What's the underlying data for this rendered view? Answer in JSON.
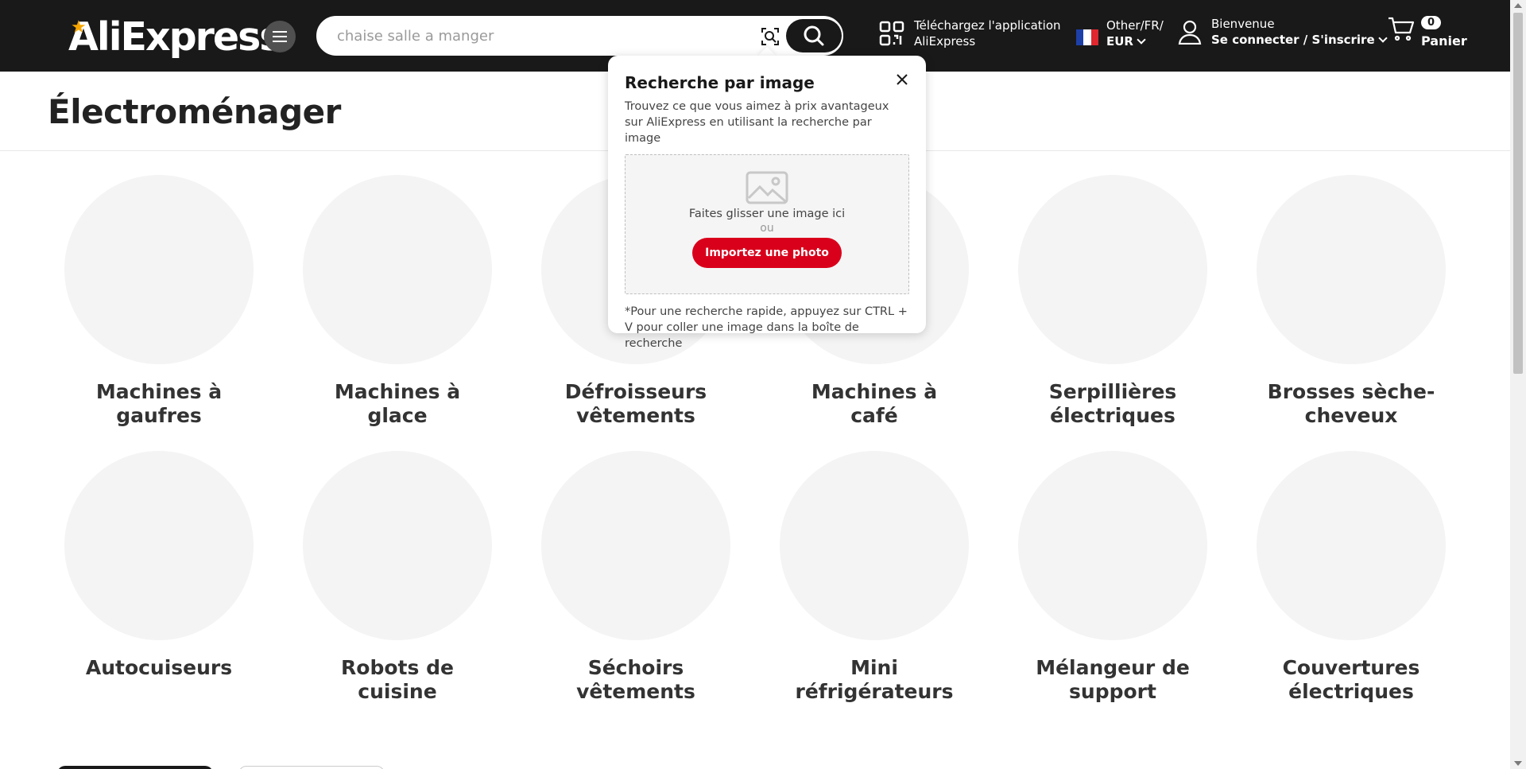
{
  "header": {
    "logo_text": "AliExpress",
    "search_placeholder": "chaise salle a manger",
    "app_download": {
      "line1": "Téléchargez l'application",
      "line2": "AliExpress"
    },
    "language": {
      "line1": "Other/FR/",
      "currency": "EUR"
    },
    "account": {
      "greeting": "Bienvenue",
      "action": "Se connecter / S'inscrire"
    },
    "cart": {
      "count": "0",
      "label": "Panier"
    }
  },
  "page": {
    "title": "Électroménager"
  },
  "categories": [
    {
      "label": "Machines à gaufres"
    },
    {
      "label": "Machines à glace"
    },
    {
      "label": "Défroisseurs vêtements"
    },
    {
      "label": "Machines à café"
    },
    {
      "label": "Serpillières électriques"
    },
    {
      "label": "Brosses sèche-cheveux"
    },
    {
      "label": "Autocuiseurs"
    },
    {
      "label": "Robots de cuisine"
    },
    {
      "label": "Séchoirs vêtements"
    },
    {
      "label": "Mini réfrigérateurs"
    },
    {
      "label": "Mélangeur de support"
    },
    {
      "label": "Couvertures électriques"
    }
  ],
  "image_search_popup": {
    "title": "Recherche par image",
    "description": "Trouvez ce que vous aimez à prix avantageux sur AliExpress en utilisant la recherche par image",
    "drop_text": "Faites glisser une image ici",
    "or_text": "ou",
    "upload_label": "Importez une photo",
    "tip": "*Pour une recherche rapide, appuyez sur CTRL + V pour coller une image dans la boîte de recherche"
  },
  "colors": {
    "header_bg": "#191919",
    "accent_red": "#d9001b",
    "logo_star": "#f7a600",
    "placeholder_circle": "#f4f4f4"
  }
}
